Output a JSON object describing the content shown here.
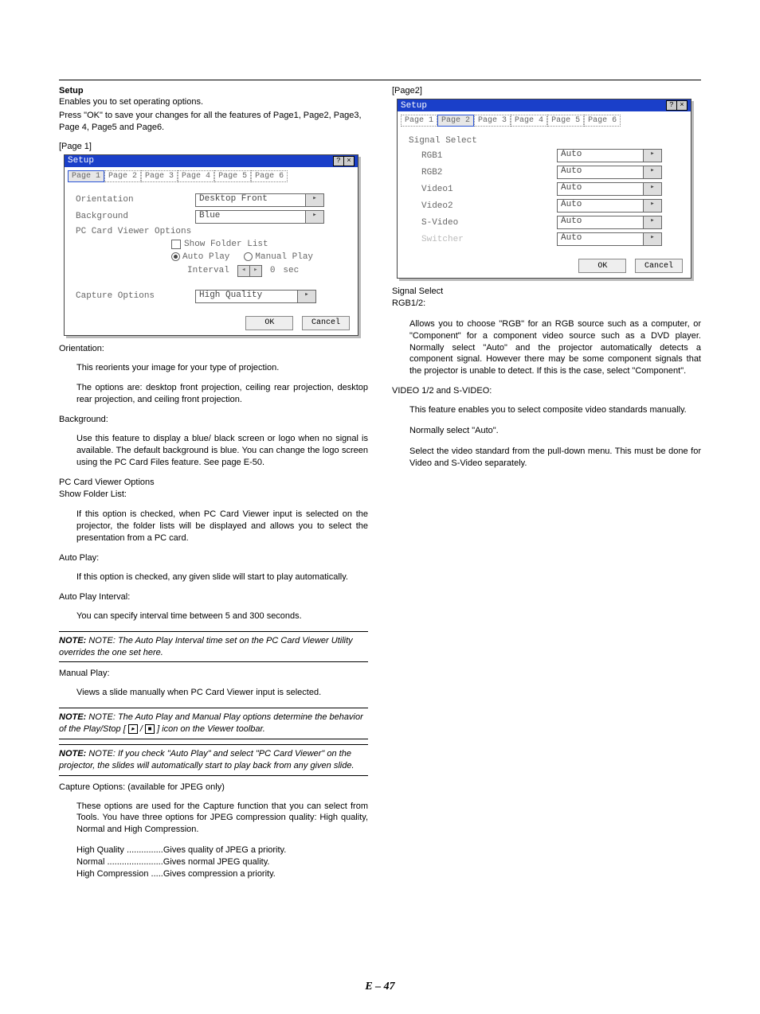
{
  "page_number": "E – 47",
  "left": {
    "heading": "Setup",
    "intro1": "Enables you to set operating options.",
    "intro2": "Press \"OK\" to save your changes for all the features of Page1, Page2, Page3, Page 4, Page5 and Page6.",
    "page1_label": "[Page 1]",
    "dialog": {
      "title": "Setup",
      "tabs": [
        "Page 1",
        "Page 2",
        "Page 3",
        "Page 4",
        "Page 5",
        "Page 6"
      ],
      "orientation_lbl": "Orientation",
      "orientation_val": "Desktop Front",
      "background_lbl": "Background",
      "background_val": "Blue",
      "pc_viewer_lbl": "PC Card Viewer Options",
      "show_folder": "Show Folder List",
      "auto_play": "Auto Play",
      "manual_play": "Manual Play",
      "interval_lbl": "Interval",
      "interval_val": "0",
      "interval_unit": "sec",
      "capture_lbl": "Capture Options",
      "capture_val": "High Quality",
      "ok": "OK",
      "cancel": "Cancel"
    },
    "orientation_h": "Orientation:",
    "orientation_p1": "This reorients your image for your type of projection.",
    "orientation_p2": "The options are: desktop front projection, ceiling rear projection, desktop rear projection, and ceiling front projection.",
    "background_h": "Background:",
    "background_p": "Use this feature to display a blue/ black screen or logo when no signal is available. The default background is blue. You can change the logo screen using the PC Card Files feature. See page E-50.",
    "pcv_h": "PC Card Viewer Options",
    "sfl_h": "Show Folder List:",
    "sfl_p": "If this option is checked, when PC Card Viewer input is selected on the projector, the folder lists will be displayed and allows you to select the presentation from a PC card.",
    "ap_h": "Auto Play:",
    "ap_p": "If this option is checked, any given slide will start to play automatically.",
    "api_h": "Auto Play Interval:",
    "api_p": "You can specify interval time between 5 and 300 seconds.",
    "note1": "NOTE: The Auto Play Interval time set on the PC Card Viewer Utility overrides the one set here.",
    "mp_h": "Manual Play:",
    "mp_p": "Views a slide manually when PC Card Viewer input is selected.",
    "note2a": "NOTE: The Auto Play and Manual Play options determine the behavior of the Play/Stop [",
    "note2b": "] icon on the Viewer toolbar.",
    "note3": "NOTE: If you check \"Auto Play\" and select \"PC Card Viewer\" on the projector, the slides will automatically start to play back from any given slide.",
    "co_h": "Capture Options: (available for JPEG only)",
    "co_p": "These options are used for the Capture function that you can select from Tools. You have three options for JPEG compression quality: High quality, Normal and High Compression.",
    "co_l1a": "High Quality ...............",
    "co_l1b": "Gives quality of JPEG a priority.",
    "co_l2a": "Normal .......................",
    "co_l2b": "Gives normal JPEG quality.",
    "co_l3a": "High Compression .....",
    "co_l3b": "Gives compression a priority."
  },
  "right": {
    "page2_label": "[Page2]",
    "dialog": {
      "title": "Setup",
      "tabs": [
        "Page 1",
        "Page 2",
        "Page 3",
        "Page 4",
        "Page 5",
        "Page 6"
      ],
      "section": "Signal Select",
      "rows": [
        {
          "k": "RGB1",
          "v": "Auto",
          "enabled": true
        },
        {
          "k": "RGB2",
          "v": "Auto",
          "enabled": true
        },
        {
          "k": "Video1",
          "v": "Auto",
          "enabled": true
        },
        {
          "k": "Video2",
          "v": "Auto",
          "enabled": true
        },
        {
          "k": "S-Video",
          "v": "Auto",
          "enabled": true
        },
        {
          "k": "Switcher",
          "v": "Auto",
          "enabled": false
        }
      ],
      "ok": "OK",
      "cancel": "Cancel"
    },
    "ss_h": "Signal Select",
    "rgb_h": "RGB1/2:",
    "rgb_p": "Allows you to choose \"RGB\" for an RGB source such as a computer, or \"Component\" for a component video source such as a DVD player. Normally select \"Auto\" and the projector automatically detects a component signal. However there may be some component signals that the projector is unable to detect. If this is the case, select \"Component\".",
    "vs_h": "VIDEO 1/2 and S-VIDEO:",
    "vs_p1": "This feature enables you to select composite video standards manually.",
    "vs_p2": "Normally select \"Auto\".",
    "vs_p3": "Select the video standard from the pull-down menu. This must be done for Video and S-Video separately."
  }
}
